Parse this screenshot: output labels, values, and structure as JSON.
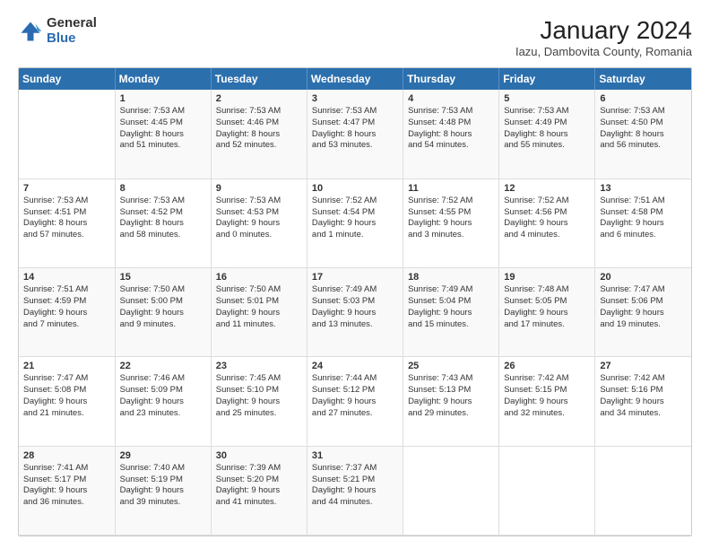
{
  "header": {
    "logo_general": "General",
    "logo_blue": "Blue",
    "month_title": "January 2024",
    "location": "Iazu, Dambovita County, Romania"
  },
  "days_of_week": [
    "Sunday",
    "Monday",
    "Tuesday",
    "Wednesday",
    "Thursday",
    "Friday",
    "Saturday"
  ],
  "weeks": [
    [
      {
        "day": "",
        "info": ""
      },
      {
        "day": "1",
        "info": "Sunrise: 7:53 AM\nSunset: 4:45 PM\nDaylight: 8 hours\nand 51 minutes."
      },
      {
        "day": "2",
        "info": "Sunrise: 7:53 AM\nSunset: 4:46 PM\nDaylight: 8 hours\nand 52 minutes."
      },
      {
        "day": "3",
        "info": "Sunrise: 7:53 AM\nSunset: 4:47 PM\nDaylight: 8 hours\nand 53 minutes."
      },
      {
        "day": "4",
        "info": "Sunrise: 7:53 AM\nSunset: 4:48 PM\nDaylight: 8 hours\nand 54 minutes."
      },
      {
        "day": "5",
        "info": "Sunrise: 7:53 AM\nSunset: 4:49 PM\nDaylight: 8 hours\nand 55 minutes."
      },
      {
        "day": "6",
        "info": "Sunrise: 7:53 AM\nSunset: 4:50 PM\nDaylight: 8 hours\nand 56 minutes."
      }
    ],
    [
      {
        "day": "7",
        "info": "Sunrise: 7:53 AM\nSunset: 4:51 PM\nDaylight: 8 hours\nand 57 minutes."
      },
      {
        "day": "8",
        "info": "Sunrise: 7:53 AM\nSunset: 4:52 PM\nDaylight: 8 hours\nand 58 minutes."
      },
      {
        "day": "9",
        "info": "Sunrise: 7:53 AM\nSunset: 4:53 PM\nDaylight: 9 hours\nand 0 minutes."
      },
      {
        "day": "10",
        "info": "Sunrise: 7:52 AM\nSunset: 4:54 PM\nDaylight: 9 hours\nand 1 minute."
      },
      {
        "day": "11",
        "info": "Sunrise: 7:52 AM\nSunset: 4:55 PM\nDaylight: 9 hours\nand 3 minutes."
      },
      {
        "day": "12",
        "info": "Sunrise: 7:52 AM\nSunset: 4:56 PM\nDaylight: 9 hours\nand 4 minutes."
      },
      {
        "day": "13",
        "info": "Sunrise: 7:51 AM\nSunset: 4:58 PM\nDaylight: 9 hours\nand 6 minutes."
      }
    ],
    [
      {
        "day": "14",
        "info": "Sunrise: 7:51 AM\nSunset: 4:59 PM\nDaylight: 9 hours\nand 7 minutes."
      },
      {
        "day": "15",
        "info": "Sunrise: 7:50 AM\nSunset: 5:00 PM\nDaylight: 9 hours\nand 9 minutes."
      },
      {
        "day": "16",
        "info": "Sunrise: 7:50 AM\nSunset: 5:01 PM\nDaylight: 9 hours\nand 11 minutes."
      },
      {
        "day": "17",
        "info": "Sunrise: 7:49 AM\nSunset: 5:03 PM\nDaylight: 9 hours\nand 13 minutes."
      },
      {
        "day": "18",
        "info": "Sunrise: 7:49 AM\nSunset: 5:04 PM\nDaylight: 9 hours\nand 15 minutes."
      },
      {
        "day": "19",
        "info": "Sunrise: 7:48 AM\nSunset: 5:05 PM\nDaylight: 9 hours\nand 17 minutes."
      },
      {
        "day": "20",
        "info": "Sunrise: 7:47 AM\nSunset: 5:06 PM\nDaylight: 9 hours\nand 19 minutes."
      }
    ],
    [
      {
        "day": "21",
        "info": "Sunrise: 7:47 AM\nSunset: 5:08 PM\nDaylight: 9 hours\nand 21 minutes."
      },
      {
        "day": "22",
        "info": "Sunrise: 7:46 AM\nSunset: 5:09 PM\nDaylight: 9 hours\nand 23 minutes."
      },
      {
        "day": "23",
        "info": "Sunrise: 7:45 AM\nSunset: 5:10 PM\nDaylight: 9 hours\nand 25 minutes."
      },
      {
        "day": "24",
        "info": "Sunrise: 7:44 AM\nSunset: 5:12 PM\nDaylight: 9 hours\nand 27 minutes."
      },
      {
        "day": "25",
        "info": "Sunrise: 7:43 AM\nSunset: 5:13 PM\nDaylight: 9 hours\nand 29 minutes."
      },
      {
        "day": "26",
        "info": "Sunrise: 7:42 AM\nSunset: 5:15 PM\nDaylight: 9 hours\nand 32 minutes."
      },
      {
        "day": "27",
        "info": "Sunrise: 7:42 AM\nSunset: 5:16 PM\nDaylight: 9 hours\nand 34 minutes."
      }
    ],
    [
      {
        "day": "28",
        "info": "Sunrise: 7:41 AM\nSunset: 5:17 PM\nDaylight: 9 hours\nand 36 minutes."
      },
      {
        "day": "29",
        "info": "Sunrise: 7:40 AM\nSunset: 5:19 PM\nDaylight: 9 hours\nand 39 minutes."
      },
      {
        "day": "30",
        "info": "Sunrise: 7:39 AM\nSunset: 5:20 PM\nDaylight: 9 hours\nand 41 minutes."
      },
      {
        "day": "31",
        "info": "Sunrise: 7:37 AM\nSunset: 5:21 PM\nDaylight: 9 hours\nand 44 minutes."
      },
      {
        "day": "",
        "info": ""
      },
      {
        "day": "",
        "info": ""
      },
      {
        "day": "",
        "info": ""
      }
    ]
  ]
}
